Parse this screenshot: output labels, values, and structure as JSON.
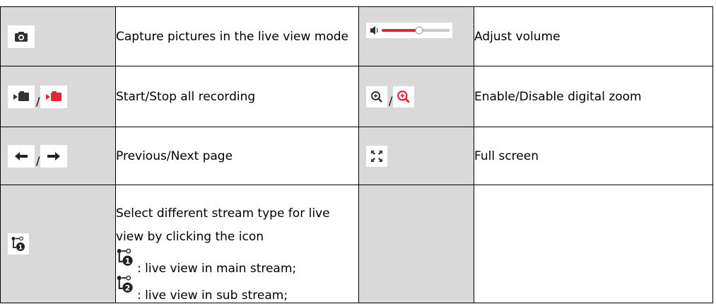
{
  "rows": [
    {
      "left_text": "Capture pictures in the live view mode",
      "left_icons": [
        "camera-icon"
      ],
      "right_text": "Adjust volume",
      "right_icons": [
        "volume-slider-icon"
      ]
    },
    {
      "left_text": "Start/Stop all recording",
      "left_icons": [
        "record-icon",
        "record-active-icon"
      ],
      "left_separator": "/",
      "right_text": "Enable/Disable digital zoom",
      "right_icons": [
        "zoom-in-icon",
        "zoom-in-active-icon"
      ],
      "right_separator": "/"
    },
    {
      "left_text": "Previous/Next page",
      "left_icons": [
        "arrow-left-icon",
        "arrow-right-icon"
      ],
      "left_separator": "/",
      "right_text": "Full screen",
      "right_icons": [
        "fullscreen-icon"
      ]
    },
    {
      "left_text": "Select different stream type for live view by clicking the icon",
      "main_stream_text": ": live view in main stream;",
      "sub_stream_text": ": live view in sub stream;",
      "left_icons": [
        "stream-main-icon"
      ],
      "inline_icons": [
        "stream-main-icon",
        "stream-sub-icon"
      ]
    }
  ],
  "colors": {
    "icon_cell_bg": "#d9d9d9",
    "icon_dark": "#333333",
    "icon_active_red": "#e8242e",
    "volume_level_red": "#e8242e"
  }
}
